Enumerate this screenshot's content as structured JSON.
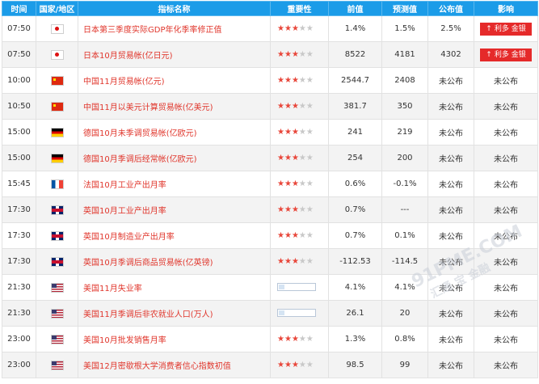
{
  "header": {
    "time": "时间",
    "country": "国家/地区",
    "indicator": "指标名称",
    "importance": "重要性",
    "previous": "前值",
    "forecast": "预测值",
    "actual": "公布值",
    "impact": "影响"
  },
  "rows": [
    {
      "time": "07:50",
      "flag": "jp",
      "name": "日本第三季度实际GDP年化季率修正值",
      "stars": 3,
      "previous": "1.4%",
      "forecast": "1.5%",
      "actual": "2.5%",
      "impact": "利多 金银",
      "impact_badge": true
    },
    {
      "time": "07:50",
      "flag": "jp",
      "name": "日本10月贸易帐(亿日元)",
      "stars": 3,
      "previous": "8522",
      "forecast": "4181",
      "actual": "4302",
      "impact": "利多 金银",
      "impact_badge": true
    },
    {
      "time": "10:00",
      "flag": "cn",
      "name": "中国11月贸易帐(亿元)",
      "stars": 3,
      "previous": "2544.7",
      "forecast": "2408",
      "actual": "未公布",
      "impact": "未公布",
      "impact_badge": false
    },
    {
      "time": "10:50",
      "flag": "cn",
      "name": "中国11月以美元计算贸易帐(亿美元)",
      "stars": 3,
      "previous": "381.7",
      "forecast": "350",
      "actual": "未公布",
      "impact": "未公布",
      "impact_badge": false
    },
    {
      "time": "15:00",
      "flag": "de",
      "name": "德国10月未季调贸易帐(亿欧元)",
      "stars": 3,
      "previous": "241",
      "forecast": "219",
      "actual": "未公布",
      "impact": "未公布",
      "impact_badge": false
    },
    {
      "time": "15:00",
      "flag": "de",
      "name": "德国10月季调后经常帐(亿欧元)",
      "stars": 3,
      "previous": "254",
      "forecast": "200",
      "actual": "未公布",
      "impact": "未公布",
      "impact_badge": false
    },
    {
      "time": "15:45",
      "flag": "fr",
      "name": "法国10月工业产出月率",
      "stars": 3,
      "previous": "0.6%",
      "forecast": "-0.1%",
      "actual": "未公布",
      "impact": "未公布",
      "impact_badge": false
    },
    {
      "time": "17:30",
      "flag": "gb",
      "name": "英国10月工业产出月率",
      "stars": 3,
      "previous": "0.7%",
      "forecast": "---",
      "actual": "未公布",
      "impact": "未公布",
      "impact_badge": false
    },
    {
      "time": "17:30",
      "flag": "gb",
      "name": "英国10月制造业产出月率",
      "stars": 3,
      "previous": "0.7%",
      "forecast": "0.1%",
      "actual": "未公布",
      "impact": "未公布",
      "impact_badge": false
    },
    {
      "time": "17:30",
      "flag": "gb",
      "name": "英国10月季调后商品贸易帐(亿英镑)",
      "stars": 3,
      "previous": "-112.53",
      "forecast": "-114.5",
      "actual": "未公布",
      "impact": "未公布",
      "impact_badge": false
    },
    {
      "time": "21:30",
      "flag": "us",
      "name": "美国11月失业率",
      "stars": 0,
      "previous": "4.1%",
      "forecast": "4.1%",
      "actual": "未公布",
      "impact": "未公布",
      "impact_badge": false
    },
    {
      "time": "21:30",
      "flag": "us",
      "name": "美国11月季调后非农就业人口(万人)",
      "stars": 0,
      "previous": "26.1",
      "forecast": "20",
      "actual": "未公布",
      "impact": "未公布",
      "impact_badge": false
    },
    {
      "time": "23:00",
      "flag": "us",
      "name": "美国10月批发销售月率",
      "stars": 3,
      "previous": "1.3%",
      "forecast": "0.8%",
      "actual": "未公布",
      "impact": "未公布",
      "impact_badge": false
    },
    {
      "time": "23:00",
      "flag": "us",
      "name": "美国12月密歇根大学消费者信心指数初值",
      "stars": 3,
      "previous": "98.5",
      "forecast": "99",
      "actual": "未公布",
      "impact": "未公布",
      "impact_badge": false
    }
  ],
  "watermark": {
    "line1": "91PME.COM",
    "line2": "汇通 宝 金融"
  }
}
